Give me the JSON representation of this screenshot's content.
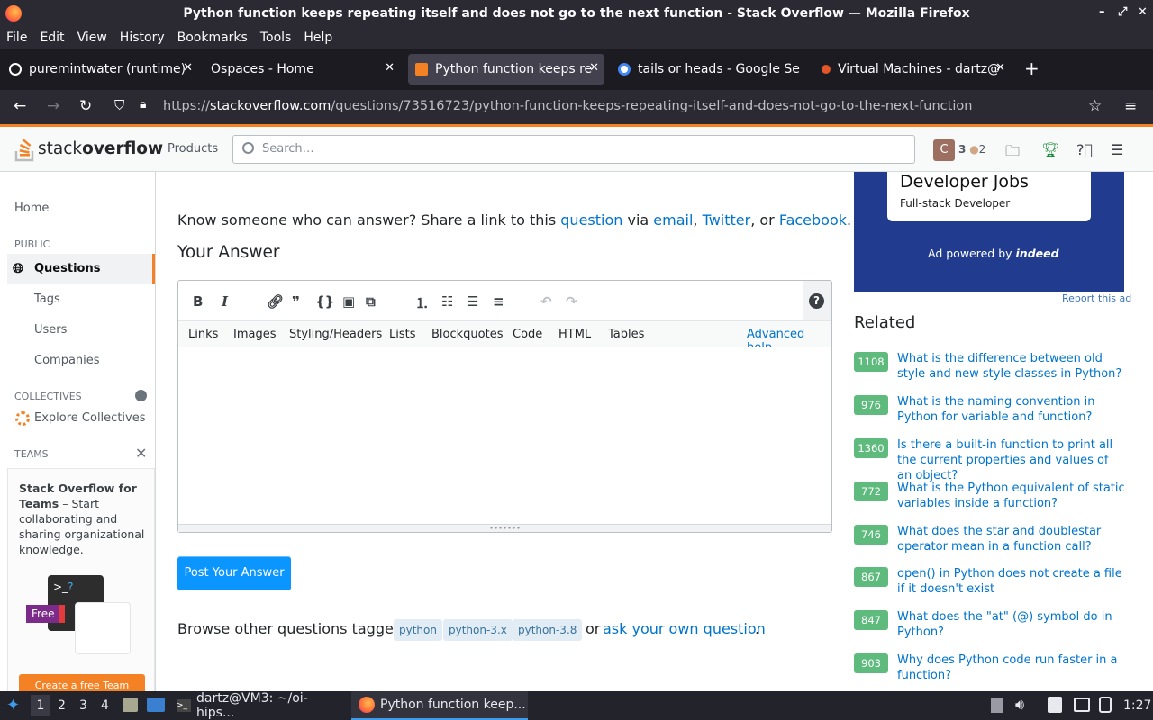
{
  "window": {
    "title": "Python function keeps repeating itself and does not go to the next function - Stack Overflow — Mozilla Firefox"
  },
  "menubar": [
    "File",
    "Edit",
    "View",
    "History",
    "Bookmarks",
    "Tools",
    "Help"
  ],
  "tabs": [
    {
      "label": "puremintwater (runtime)",
      "color": "#ffffff"
    },
    {
      "label": "Ospaces - Home",
      "color": ""
    },
    {
      "label": "Python function keeps re",
      "color": "#f48225"
    },
    {
      "label": "tails or heads - Google Se",
      "color": "#4285f4"
    },
    {
      "label": "Virtual Machines - dartz@",
      "color": "#e2562a"
    }
  ],
  "url": {
    "prefix": "https://",
    "host": "stackoverflow.com",
    "path": "/questions/73516723/python-function-keeps-repeating-itself-and-does-not-go-to-the-next-function"
  },
  "so_header": {
    "logo_light": "stack",
    "logo_bold": "overflow",
    "products": "Products",
    "search_placeholder": "Search…",
    "avatar": "C",
    "rep": "3",
    "bronze": "2"
  },
  "sidebar": {
    "home": "Home",
    "public": "PUBLIC",
    "questions": "Questions",
    "tags": "Tags",
    "users": "Users",
    "companies": "Companies",
    "collectives": "COLLECTIVES",
    "explore": "Explore Collectives",
    "teams": "TEAMS",
    "teams_title": "Stack Overflow for Teams",
    "teams_text": " – Start collaborating and sharing organizational knowledge.",
    "free": "Free",
    "create_team": "Create a free Team"
  },
  "main": {
    "share_prefix": "Know someone who can answer? Share a link to this ",
    "share_question": "question",
    "share_via": " via ",
    "share_email": "email",
    "share_twitter": "Twitter",
    "share_or": ", or ",
    "share_facebook": "Facebook",
    "your_answer": "Your Answer",
    "help_links": [
      "Links",
      "Images",
      "Styling/Headers",
      "Lists",
      "Blockquotes",
      "Code",
      "HTML",
      "Tables"
    ],
    "advanced_help": "Advanced help",
    "post_button": "Post Your Answer",
    "browse_prefix": "Browse other questions tagged",
    "tags": [
      "python",
      "python-3.x",
      "python-3.8"
    ],
    "or": "or",
    "ask": "ask your own question"
  },
  "ad": {
    "title": "Developer Jobs",
    "subtitle": "Full-stack Developer",
    "powered_prefix": "Ad powered by ",
    "powered_brand": "indeed",
    "report": "Report this ad"
  },
  "related": {
    "heading": "Related",
    "items": [
      {
        "score": "1108",
        "title": "What is the difference between old style and new style classes in Python?"
      },
      {
        "score": "976",
        "title": "What is the naming convention in Python for variable and function?"
      },
      {
        "score": "1360",
        "title": "Is there a built-in function to print all the current properties and values of an object?"
      },
      {
        "score": "772",
        "title": "What is the Python equivalent of static variables inside a function?"
      },
      {
        "score": "746",
        "title": "What does the star and doublestar operator mean in a function call?"
      },
      {
        "score": "867",
        "title": "open() in Python does not create a file if it doesn't exist"
      },
      {
        "score": "847",
        "title": "What does the \"at\" (@) symbol do in Python?"
      },
      {
        "score": "903",
        "title": "Why does Python code run faster in a function?"
      }
    ]
  },
  "taskbar": {
    "workspaces": [
      "1",
      "2",
      "3",
      "4"
    ],
    "terminal": "dartz@VM3: ~/oi-hips...",
    "firefox": "Python function keep...",
    "clock": "1:27"
  }
}
